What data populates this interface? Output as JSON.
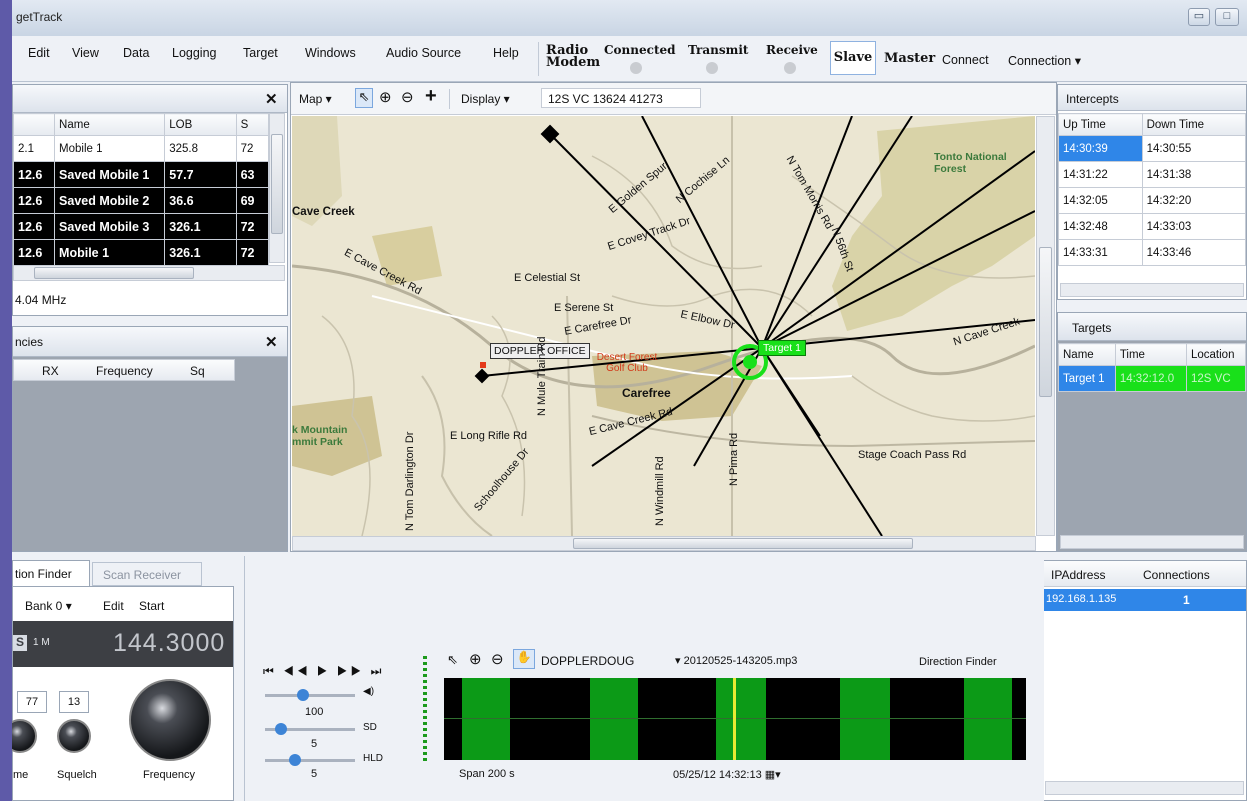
{
  "window": {
    "title": "getTrack",
    "min_glyph": "▭",
    "max_glyph": "□"
  },
  "menu": {
    "items": [
      "Edit",
      "View",
      "Data",
      "Logging",
      "Target",
      "Windows",
      "Audio Source",
      "Help"
    ],
    "radio_modem": "Radio Modem",
    "connected": "Connected",
    "transmit": "Transmit",
    "receive": "Receive",
    "slave": "Slave",
    "master": "Master",
    "connect": "Connect",
    "connection": "Connection ▾"
  },
  "mobiles": {
    "headers": [
      "Name",
      "LOB",
      "S"
    ],
    "rows": [
      {
        "id": "2.1",
        "name": "Mobile 1",
        "lob": "325.8",
        "s": "72",
        "highlight": false
      },
      {
        "id": "12.6",
        "name": "Saved Mobile 1",
        "lob": "57.7",
        "s": "63",
        "highlight": true
      },
      {
        "id": "12.6",
        "name": "Saved Mobile 2",
        "lob": "36.6",
        "s": "69",
        "highlight": true
      },
      {
        "id": "12.6",
        "name": "Saved Mobile 3",
        "lob": "326.1",
        "s": "72",
        "highlight": true
      },
      {
        "id": "12.6",
        "name": "Mobile 1",
        "lob": "326.1",
        "s": "72",
        "highlight": true
      }
    ],
    "freq": "4.04 MHz"
  },
  "frequencies": {
    "title": "ncies",
    "headers": [
      "RX",
      "Frequency",
      "Sq"
    ]
  },
  "map": {
    "menu": "Map ▾",
    "display": "Display ▾",
    "coords": "12S VC 13624 41273",
    "labels": {
      "cave_creek": "Cave Creek",
      "doppler_office": "DOPPLER OFFICE",
      "carefree": "Carefree",
      "target1": "Target 1",
      "golf": "Desert Forest Golf Club",
      "forest": "Tonto National Forest",
      "mountain": "k Mountain mmit Park",
      "stagecoach": "Stage Coach Pass Rd",
      "long_rifle": "E Long Rifle Rd",
      "cave_creek_rd": "E Cave Creek Rd",
      "celestial": "E Celestial St",
      "serene": "E Serene St",
      "carefree_dr": "E Carefree Dr",
      "elbow": "E Elbow Dr",
      "covey": "E Covey Track Dr",
      "golden": "E Golden Spur",
      "cochise": "N Cochise Ln",
      "mule": "N Mule Train Rd",
      "windmill": "N Windmill Rd",
      "pima": "N Pima Rd",
      "schoolhouse": "Schoolhouse Dr",
      "darlington": "N Tom Darlington Dr",
      "n_cave": "N Cave Creek",
      "tom_morris": "N Tom Morris Rd",
      "n_56": "N 56th St",
      "cave_creek_rd_w": "E Cave Creek Rd"
    }
  },
  "intercepts": {
    "title": "Intercepts",
    "headers": [
      "Up Time",
      "Down Time"
    ],
    "rows": [
      [
        "14:30:39",
        "14:30:55"
      ],
      [
        "14:31:22",
        "14:31:38"
      ],
      [
        "14:32:05",
        "14:32:20"
      ],
      [
        "14:32:48",
        "14:33:03"
      ],
      [
        "14:33:31",
        "14:33:46"
      ]
    ]
  },
  "targets": {
    "title": "Targets",
    "headers": [
      "Name",
      "Time",
      "Location"
    ],
    "rows": [
      [
        "Target 1",
        "14:32:12.0",
        "12S VC"
      ]
    ]
  },
  "connections": {
    "headers": [
      "IPAddress",
      "Connections"
    ],
    "rows": [
      [
        "192.168.1.135",
        "1"
      ]
    ]
  },
  "scanner": {
    "tab1": "tion Finder",
    "tab2": "Scan Receiver",
    "bank": "Bank 0",
    "edit": "Edit",
    "start": "Start",
    "mode": "S",
    "mode_sub": "1 M",
    "frequency": "144.3000",
    "vol": "77",
    "squelch_val": "13",
    "vol_label": "me",
    "squelch_label": "Squelch",
    "freq_label": "Frequency"
  },
  "audio": {
    "slider1": "100",
    "slider2": "5",
    "slider3": "5",
    "sd": "SD",
    "hld": "HLD",
    "source": "DOPPLERDOUG",
    "file": "20120525-143205.mp3",
    "mode": "Direction Finder",
    "span": "Span 200 s",
    "datetime": "05/25/12 14:32:13"
  }
}
